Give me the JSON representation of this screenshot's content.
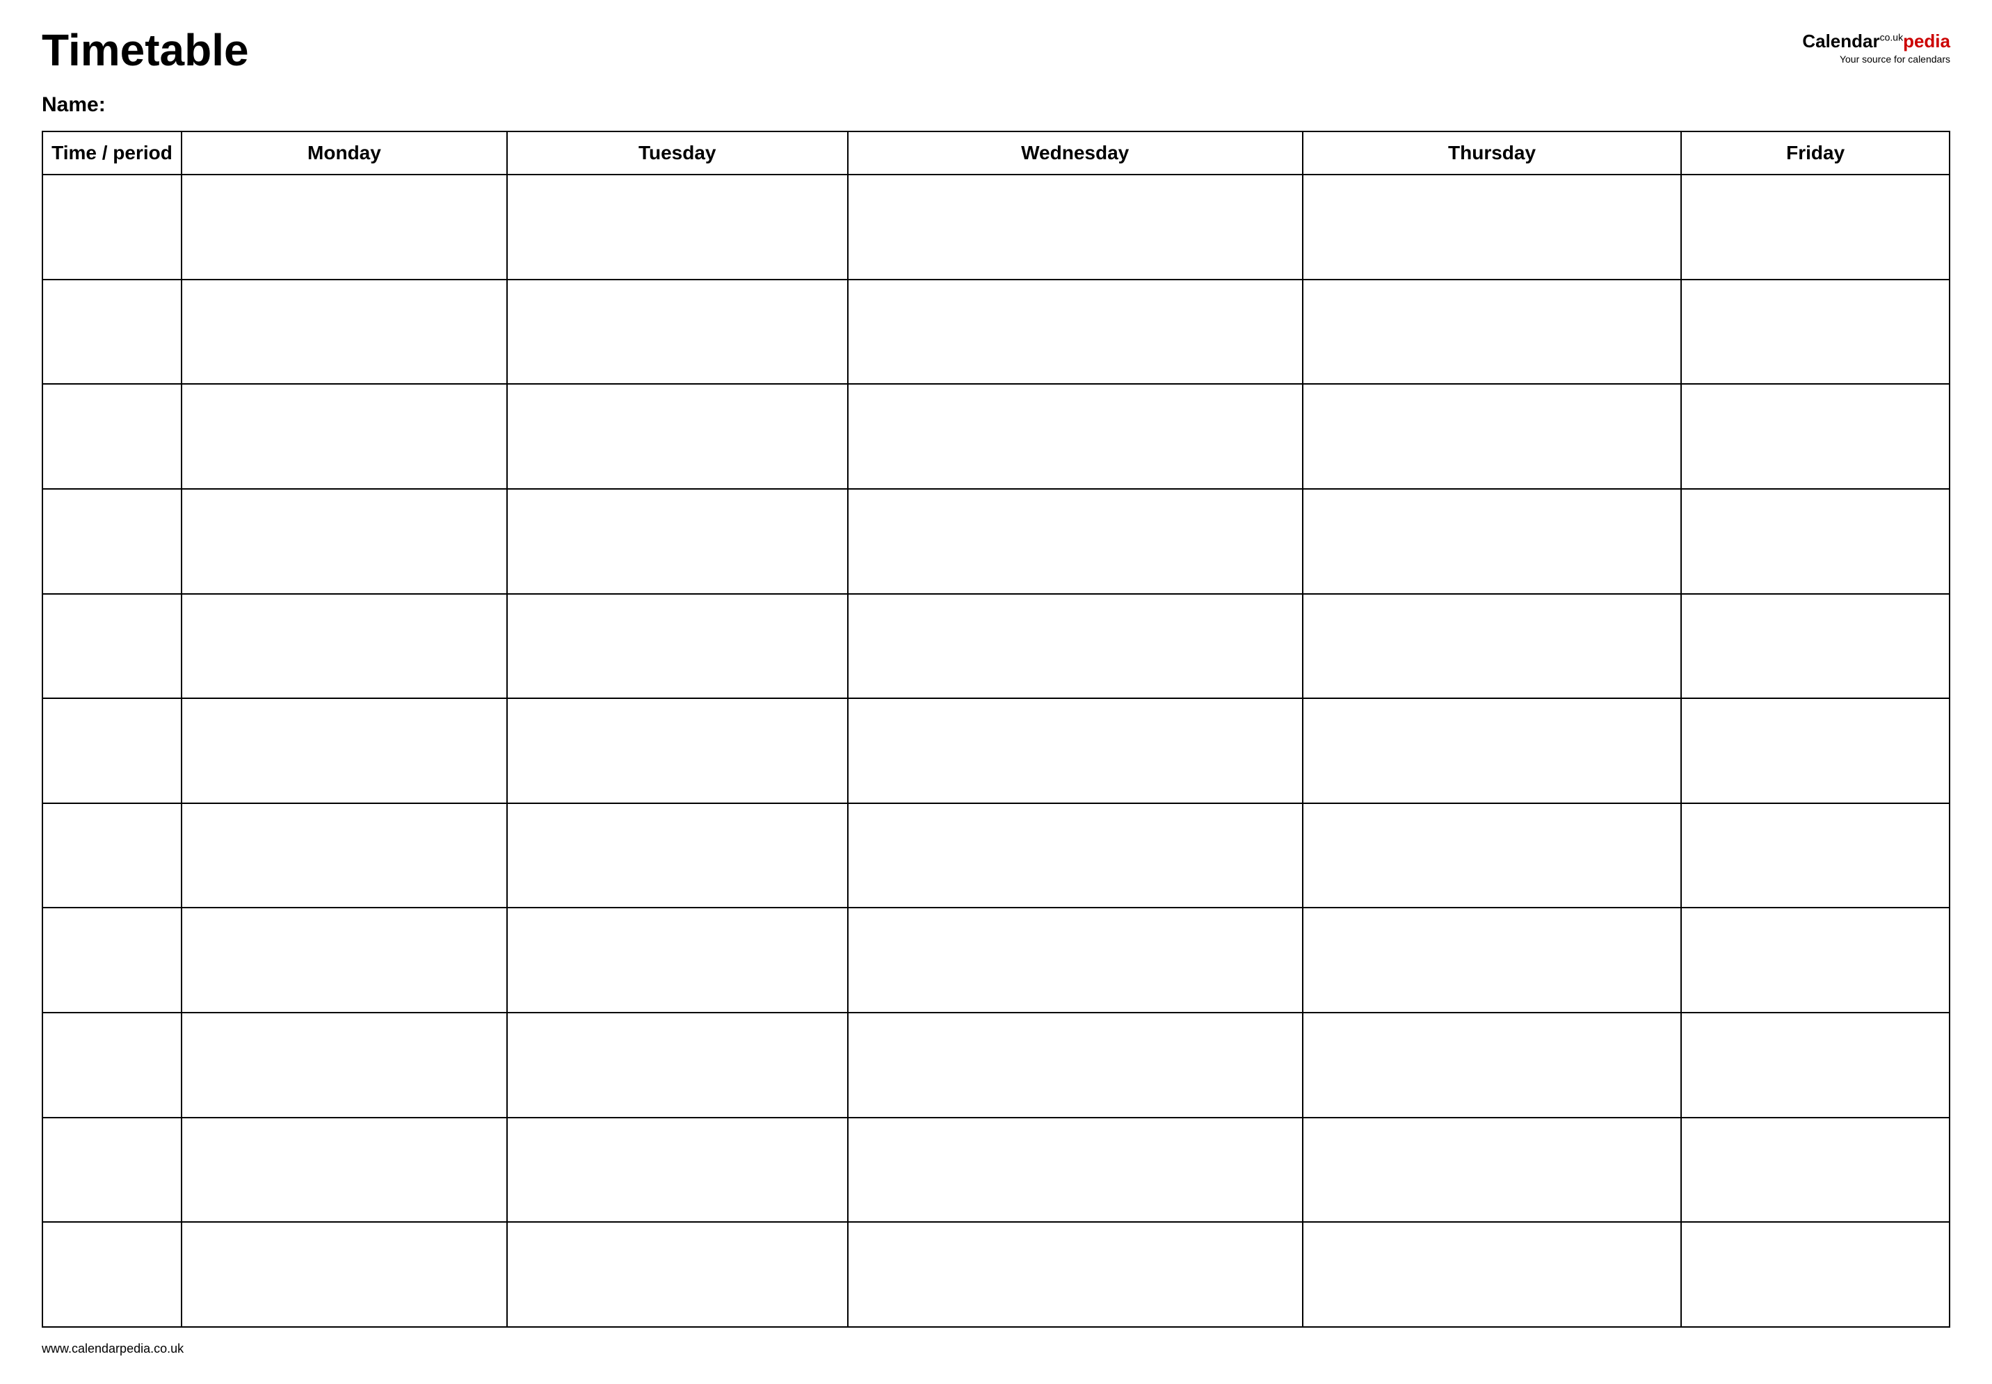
{
  "header": {
    "title": "Timetable",
    "logo": {
      "calendar_text": "Calendar",
      "pedia_text": "pedia",
      "co_uk": "co.uk",
      "subtitle": "Your source for calendars"
    }
  },
  "name_section": {
    "label": "Name:"
  },
  "table": {
    "columns": [
      {
        "label": "Time / period"
      },
      {
        "label": "Monday"
      },
      {
        "label": "Tuesday"
      },
      {
        "label": "Wednesday"
      },
      {
        "label": "Thursday"
      },
      {
        "label": "Friday"
      }
    ],
    "row_count": 11
  },
  "footer": {
    "url": "www.calendarpedia.co.uk"
  }
}
